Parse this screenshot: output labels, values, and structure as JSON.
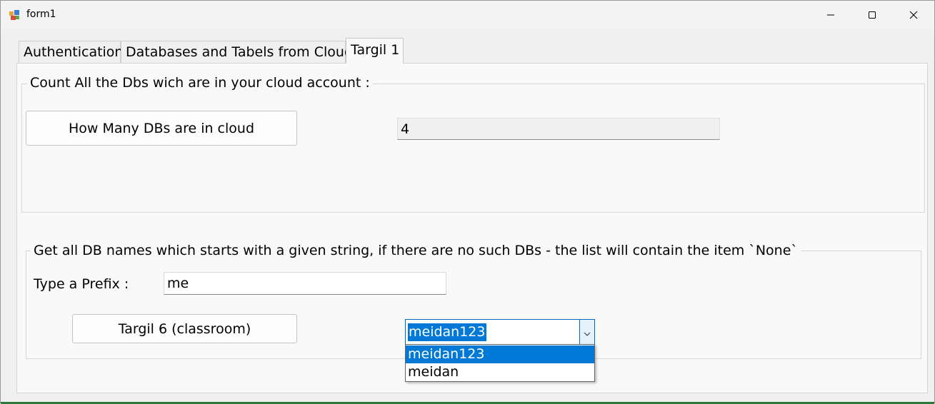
{
  "window": {
    "title": "form1"
  },
  "tabs": [
    {
      "label": "Authentication",
      "selected": false
    },
    {
      "label": "Databases and Tabels from Cloud",
      "selected": false
    },
    {
      "label": "Targil 1",
      "selected": true
    }
  ],
  "group1": {
    "title": "Count All the Dbs wich are in your cloud account :",
    "button_label": "How Many DBs are in cloud",
    "result_value": "4"
  },
  "group2": {
    "title": "Get all DB names which starts with a given string, if there are no such DBs - the list will contain the item `None`",
    "prefix_label": "Type a Prefix :",
    "prefix_value": "me",
    "button_label": "Targil 6 (classroom)",
    "combo_value": "meidan123",
    "combo_options": [
      "meidan123",
      "meidan"
    ]
  },
  "icons": {
    "app": "form-app-icon",
    "minimize": "minimize-icon",
    "maximize": "maximize-icon",
    "close": "close-icon",
    "dropdown": "chevron-down-icon"
  },
  "colors": {
    "selection": "#0078d7",
    "focus_border": "#0067c0"
  }
}
